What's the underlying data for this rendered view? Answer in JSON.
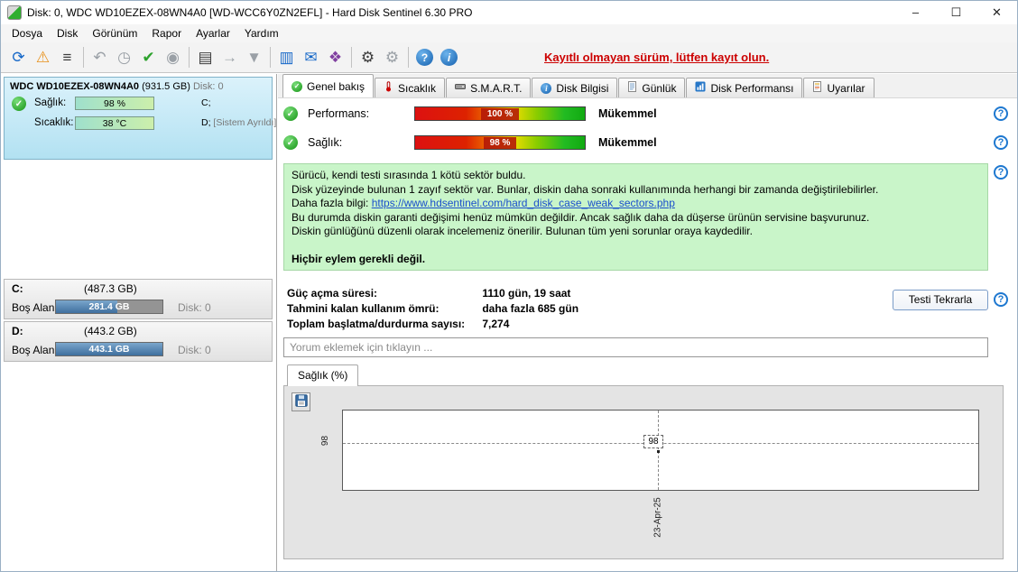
{
  "window": {
    "title": "Disk: 0, WDC WD10EZEX-08WN4A0 [WD-WCC6Y0ZN2EFL]  -  Hard Disk Sentinel 6.30 PRO",
    "controls": {
      "minimize": "–",
      "maximize": "☐",
      "close": "✕"
    }
  },
  "menu": {
    "items": [
      {
        "label": "Dosya"
      },
      {
        "label": "Disk"
      },
      {
        "label": "Görünüm"
      },
      {
        "label": "Rapor"
      },
      {
        "label": "Ayarlar"
      },
      {
        "label": "Yardım"
      }
    ]
  },
  "toolbar": {
    "register_text": "Kayıtlı olmayan sürüm, lütfen kayıt olun.",
    "icons": [
      {
        "name": "refresh-icon",
        "glyph": "⟳"
      },
      {
        "name": "analyse-warning-icon",
        "glyph": "⚠"
      },
      {
        "name": "details-view-icon",
        "glyph": "≡"
      },
      {
        "name": "disk-undo-icon",
        "glyph": "↶"
      },
      {
        "name": "disk-clock-icon",
        "glyph": "◷"
      },
      {
        "name": "disk-accept-icon",
        "glyph": "✔"
      },
      {
        "name": "disk-zoom-icon",
        "glyph": "◉"
      },
      {
        "name": "print-icon",
        "glyph": "▤"
      },
      {
        "name": "disk-export-icon",
        "glyph": "→"
      },
      {
        "name": "disk-save-icon",
        "glyph": "▼"
      },
      {
        "name": "temperature-panel-icon",
        "glyph": "▥"
      },
      {
        "name": "email-icon",
        "glyph": "✉"
      },
      {
        "name": "tools-icon",
        "glyph": "❖"
      },
      {
        "name": "settings-gear-icon",
        "glyph": "⚙"
      },
      {
        "name": "settings-zoom-icon",
        "glyph": "⚙"
      }
    ]
  },
  "sidebar": {
    "disk_panel": {
      "title": "WDC WD10EZEX-08WN4A0",
      "size": "(931.5 GB)",
      "disk_no": "Disk: 0",
      "rows": [
        {
          "label": "Sağlık:",
          "bar_value": "98 %",
          "right": "C;",
          "right_note": ""
        },
        {
          "label": "Sıcaklık:",
          "bar_value": "38 °C",
          "right": "D;",
          "right_note": "[Sistem Ayrıldı]"
        }
      ]
    },
    "volumes": [
      {
        "name": "C:",
        "size": "(487.3 GB)",
        "free_label": "Boş Alan",
        "free_value": "281.4 GB",
        "disk_no": "Disk: 0"
      },
      {
        "name": "D:",
        "size": "(443.2 GB)",
        "free_label": "Boş Alan",
        "free_value": "443.1 GB",
        "disk_no": "Disk: 0"
      }
    ]
  },
  "tabs": {
    "items": [
      {
        "label": "Genel bakış"
      },
      {
        "label": "Sıcaklık"
      },
      {
        "label": "S.M.A.R.T."
      },
      {
        "label": "Disk Bilgisi"
      },
      {
        "label": "Günlük"
      },
      {
        "label": "Disk Performansı"
      },
      {
        "label": "Uyarılar"
      }
    ]
  },
  "overview": {
    "rows": [
      {
        "label": "Performans:",
        "value": "100 %",
        "rating": "Mükemmel"
      },
      {
        "label": "Sağlık:",
        "value": "98 %",
        "rating": "Mükemmel"
      }
    ],
    "description": {
      "line1": "Sürücü, kendi testi sırasında 1 kötü sektör buldu.",
      "line2": "Disk yüzeyinde bulunan 1 zayıf sektör var. Bunlar, diskin daha sonraki kullanımında herhangi bir zamanda değiştirilebilirler.",
      "line3_prefix": "Daha fazla bilgi: ",
      "line3_link": "https://www.hdsentinel.com/hard_disk_case_weak_sectors.php",
      "line4": "Bu durumda diskin garanti değişimi henüz mümkün değildir. Ancak sağlık daha da düşerse ürünün servisine başvurunuz.",
      "line5": "Diskin günlüğünü düzenli olarak incelemeniz önerilir. Bulunan tüm yeni sorunlar oraya kaydedilir.",
      "line6": "Hiçbir eylem gerekli değil."
    },
    "stats": [
      {
        "label": "Güç açma süresi:",
        "value": "1110 gün, 19 saat"
      },
      {
        "label": "Tahmini kalan kullanım ömrü:",
        "value": "daha fazla 685 gün"
      },
      {
        "label": "Toplam başlatma/durdurma sayısı:",
        "value": "7,274"
      }
    ],
    "retest_button": "Testi Tekrarla",
    "comment_placeholder": "Yorum eklemek için tıklayın ..."
  },
  "chart": {
    "tab_label": "Sağlık (%)",
    "y_axis_label": "98",
    "x_axis_label": "23-Apr-25",
    "marker_value": "98"
  },
  "chart_data": {
    "type": "line",
    "title": "Sağlık (%)",
    "x": [
      "23-Apr-25"
    ],
    "series": [
      {
        "name": "Sağlık (%)",
        "values": [
          98
        ]
      }
    ],
    "ylabel": "Sağlık (%)",
    "ylim": [
      0,
      100
    ],
    "grid": "dashed crosshair at single point",
    "legend": "none"
  },
  "colors": {
    "accent_blue": "#1e78d0",
    "health_green": "#149314",
    "warning_red": "#cc0000",
    "desc_box_bg": "#c9f5c9",
    "volume_fill": "#3f6f9e",
    "disk_panel_bg": "#b2e1f2"
  }
}
